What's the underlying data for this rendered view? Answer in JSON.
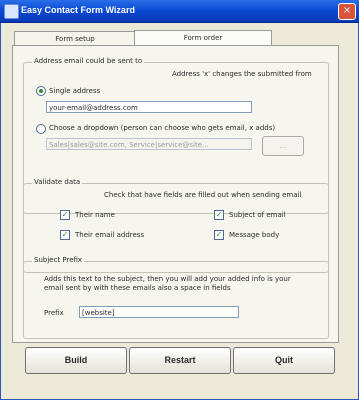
{
  "window": {
    "title": "Easy Contact Form Wizard",
    "close_glyph": "×"
  },
  "tabs": [
    {
      "label": "Form setup",
      "active": false
    },
    {
      "label": "Form order",
      "active": true
    }
  ],
  "address": {
    "legend": "Address email could be sent to",
    "right_hint": "Address 'x' changes the submitted from",
    "single_label": "Single address",
    "single_value": "your-email@address.com",
    "multi_label": "Choose a dropdown (person can choose who gets email, x adds)",
    "multi_value": "Sales|sales@site.com, Service|service@site...",
    "multi_button": "..."
  },
  "validate": {
    "legend": "Validate data",
    "hint": "Check that have fields are filled out when sending email",
    "checks": [
      {
        "label": "Their name",
        "checked": true
      },
      {
        "label": "Subject of email",
        "checked": true
      },
      {
        "label": "Their email address",
        "checked": true
      },
      {
        "label": "Message body",
        "checked": true
      }
    ]
  },
  "subject": {
    "legend": "Subject Prefix",
    "hint_line1": "Adds this text to the subject, then you will add your added info is your",
    "hint_line2": "email sent by with these emails also a space in fields",
    "prefix_label": "Prefix",
    "prefix_value": "[website]"
  },
  "buttons": {
    "build": "Build",
    "restart": "Restart",
    "quit": "Quit"
  }
}
